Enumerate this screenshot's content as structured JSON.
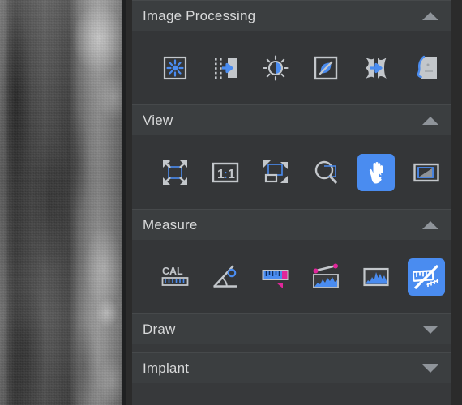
{
  "app": {
    "background_color": "#2b2b2b",
    "panel_color": "#37393b",
    "section_header_color": "#3b3e40",
    "section_body_color": "#343638",
    "accent_color": "#4a8cf0",
    "measure_accent_color": "#e0269a",
    "text_color": "#d8d9da"
  },
  "viewer": {
    "name": "dental-periapical-xray",
    "alt": "Grayscale dental periapical radiograph showing tooth roots and alveolar bone"
  },
  "sections": [
    {
      "id": "image-processing",
      "title": "Image Processing",
      "expanded": true,
      "chevron": "chevron-up-icon",
      "tools": [
        {
          "name": "sharpen-tool",
          "label": "Sharpen",
          "icon": "sharpen-icon",
          "active": false
        },
        {
          "name": "noise-reduction-tool",
          "label": "Noise Reduction",
          "icon": "noise-reduction-icon",
          "active": false
        },
        {
          "name": "brightness-contrast-tool",
          "label": "Brightness / Contrast",
          "icon": "brightness-contrast-icon",
          "active": false
        },
        {
          "name": "invert-tool",
          "label": "Invert",
          "icon": "invert-icon",
          "active": false
        },
        {
          "name": "distortion-tool",
          "label": "Distortion Correction",
          "icon": "distortion-icon",
          "active": false
        },
        {
          "name": "profile-trace-tool",
          "label": "Profile Trace",
          "icon": "head-profile-icon",
          "active": false
        }
      ]
    },
    {
      "id": "view",
      "title": "View",
      "expanded": true,
      "chevron": "chevron-up-icon",
      "tools": [
        {
          "name": "fit-to-window-tool",
          "label": "Fit to Window",
          "icon": "fit-to-window-icon",
          "active": false
        },
        {
          "name": "actual-size-tool",
          "label": "1:1",
          "icon": "one-to-one-icon",
          "active": false,
          "text": "1:1"
        },
        {
          "name": "zoom-region-tool",
          "label": "Zoom Region",
          "icon": "zoom-region-icon",
          "active": false
        },
        {
          "name": "magnifier-tool",
          "label": "Magnifier",
          "icon": "magnifier-icon",
          "active": false
        },
        {
          "name": "pan-tool",
          "label": "Pan",
          "icon": "pan-hand-icon",
          "active": true
        },
        {
          "name": "overview-tool",
          "label": "Overview",
          "icon": "overview-icon",
          "active": false
        }
      ]
    },
    {
      "id": "measure",
      "title": "Measure",
      "expanded": true,
      "chevron": "chevron-up-icon",
      "tools": [
        {
          "name": "calibrate-tool",
          "label": "Calibrate",
          "icon": "calibration-ruler-icon",
          "active": false,
          "text": "CAL"
        },
        {
          "name": "angle-tool",
          "label": "Angle",
          "icon": "angle-icon",
          "active": false
        },
        {
          "name": "distance-tool",
          "label": "Distance",
          "icon": "ruler-icon",
          "active": false
        },
        {
          "name": "line-profile-tool",
          "label": "Line Profile",
          "icon": "line-profile-icon",
          "active": false
        },
        {
          "name": "histogram-tool",
          "label": "Histogram",
          "icon": "histogram-icon",
          "active": false
        },
        {
          "name": "clear-measurements-tool",
          "label": "Clear Measurements",
          "icon": "ruler-crossed-icon",
          "active": true
        }
      ]
    },
    {
      "id": "draw",
      "title": "Draw",
      "expanded": false,
      "chevron": "chevron-down-icon",
      "tools": []
    },
    {
      "id": "implant",
      "title": "Implant",
      "expanded": false,
      "chevron": "chevron-down-icon",
      "tools": []
    }
  ]
}
